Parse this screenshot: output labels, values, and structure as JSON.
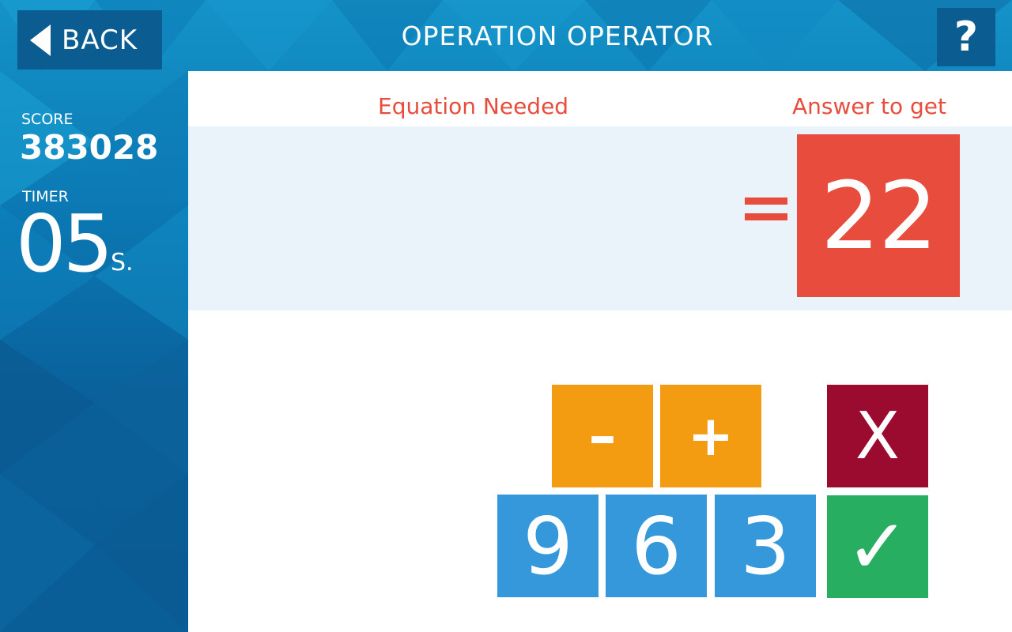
{
  "header": {
    "back_label": "BACK",
    "title": "OPERATION OPERATOR",
    "help_label": "?"
  },
  "sidebar": {
    "score_label": "SCORE",
    "score_value": "383028",
    "timer_label": "TIMER",
    "timer_value": "05",
    "timer_unit": "S."
  },
  "main": {
    "equation_header": "Equation Needed",
    "answer_header": "Answer to get",
    "answer_value": "22"
  },
  "tiles": {
    "operators": [
      "–",
      "+"
    ],
    "numbers": [
      "9",
      "6",
      "3"
    ],
    "clear_label": "X",
    "submit_label": "✓"
  },
  "colors": {
    "accent_red": "#e74c3c",
    "operator_orange": "#f39c12",
    "number_blue": "#3498db",
    "clear_maroon": "#9b0a2f",
    "submit_green": "#27ae60",
    "header_blue": "#0b5c90"
  }
}
